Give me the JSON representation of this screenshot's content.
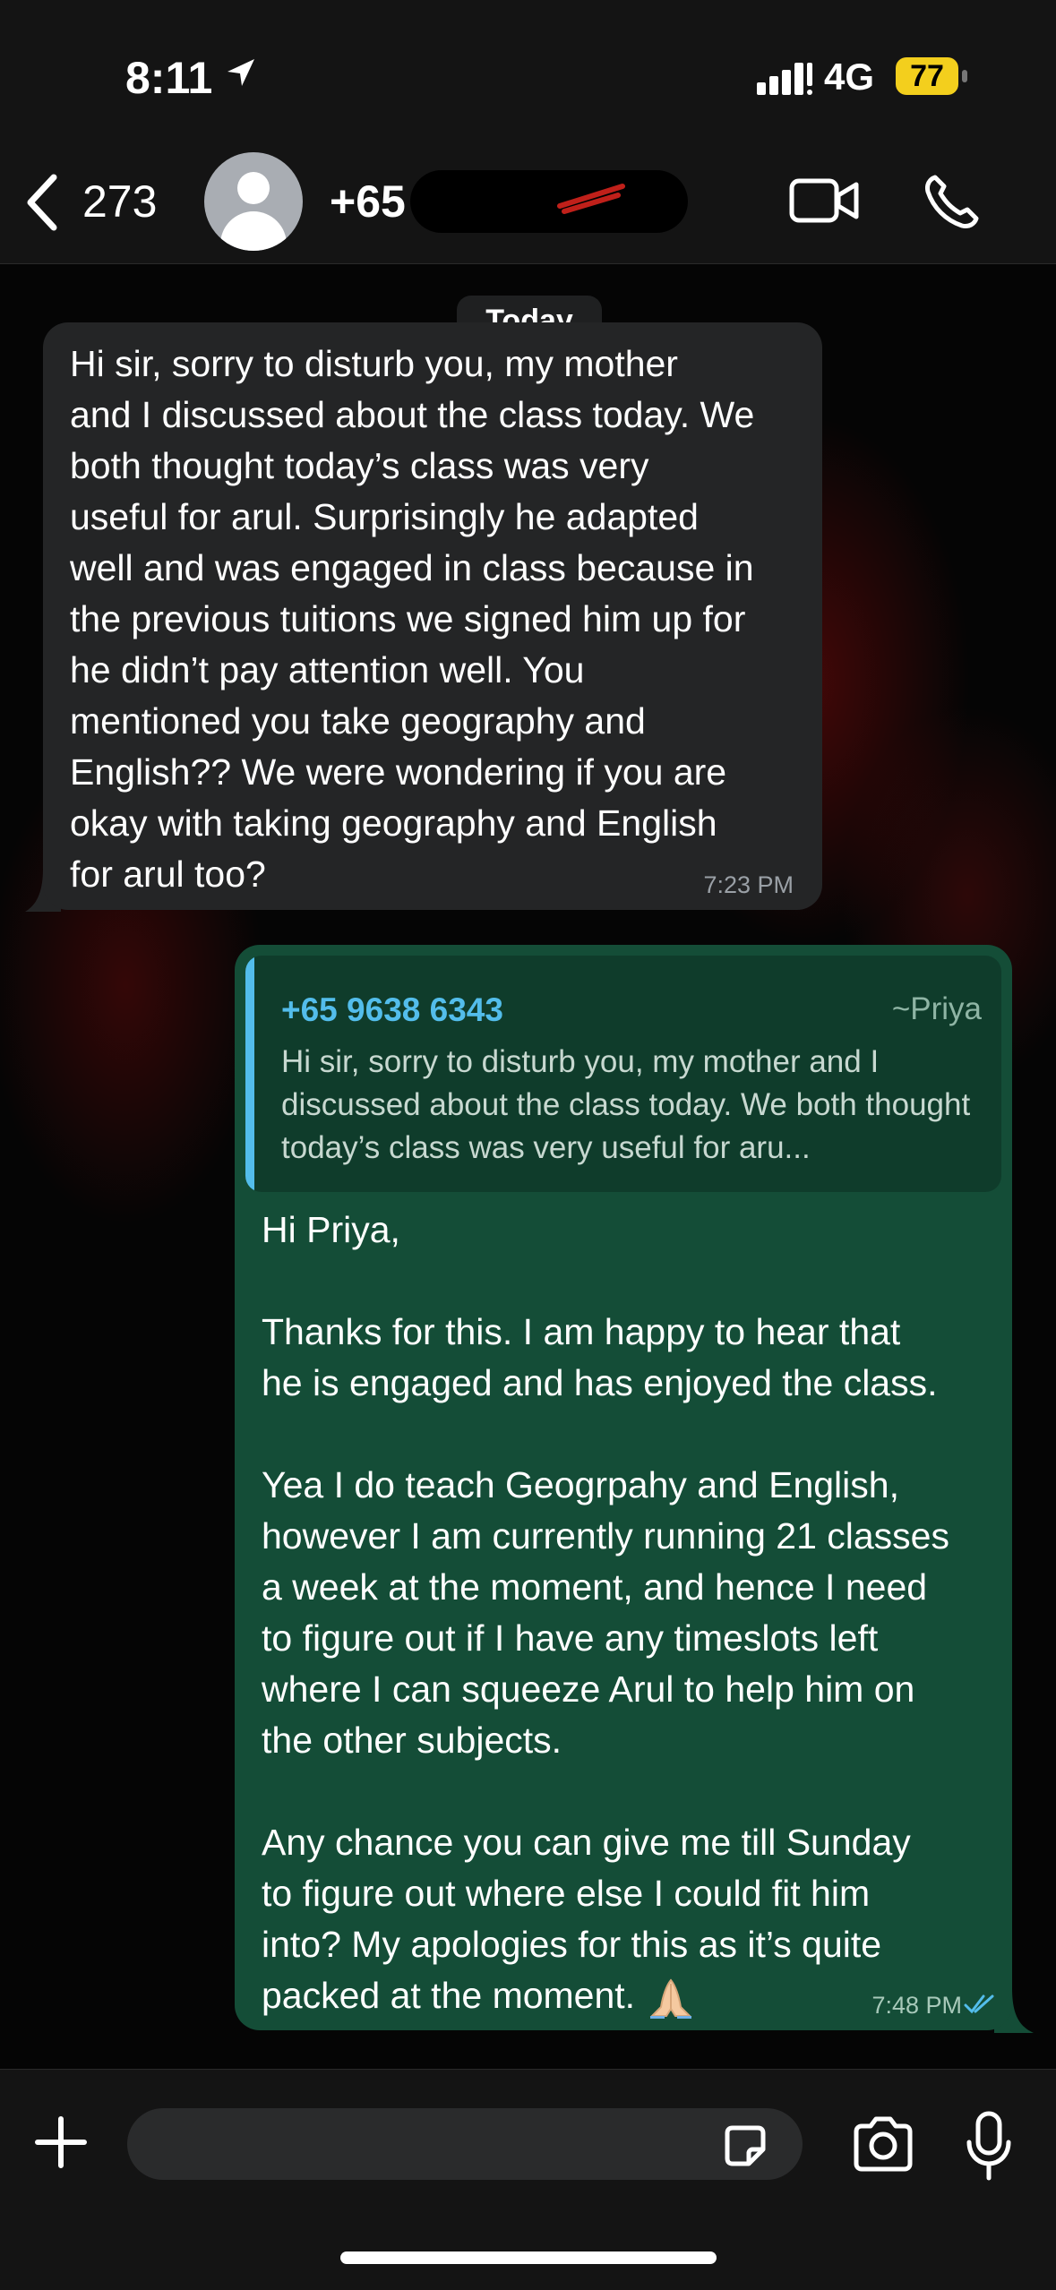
{
  "status_bar": {
    "time": "8:11",
    "network": "4G",
    "battery": "77",
    "icons": [
      "location-arrow-icon",
      "signal-icon"
    ]
  },
  "header": {
    "back_count": "273",
    "contact_name": "+65",
    "icons": [
      "chevron-left-icon",
      "avatar-icon",
      "video-call-icon",
      "phone-call-icon"
    ]
  },
  "chat": {
    "date_label": "Today",
    "messages": [
      {
        "direction": "incoming",
        "text": "Hi sir, sorry to disturb you, my mother\nand I discussed about the class today. We\nboth thought today’s class was very\nuseful for arul. Surprisingly he adapted\nwell and was engaged in class because in\nthe previous tuitions we signed him up for\nhe didn’t pay attention well. You\nmentioned you take geography and\nEnglish?? We were wondering if you are\nokay with taking geography and English\nfor arul too?",
        "time": "7:23 PM"
      },
      {
        "direction": "outgoing",
        "quoted": {
          "number": "+65 9638 6343",
          "author": "~Priya",
          "text": "Hi sir, sorry to disturb you, my mother and I discussed about the class today. We both thought today’s class was very useful for aru..."
        },
        "text": "Hi Priya,\n\nThanks for this. I am happy to hear that\nhe is engaged and has enjoyed the class.\n\nYea I do teach Geogrpahy and English,\nhowever I am currently running 21 classes\na week at the moment, and hence I need\nto figure out if I have any timeslots left\nwhere I can squeeze Arul to help him on\nthe other subjects.\n\nAny chance you can give me till Sunday\nto figure out where else I could fit him\ninto? My apologies for this as it’s quite\npacked at the moment. ",
        "emoji": "folded-hands-emoji",
        "time": "7:48 PM",
        "status_icon": "double-check-read-icon"
      }
    ]
  },
  "composer": {
    "input_value": "",
    "icons": [
      "plus-icon",
      "sticker-icon",
      "camera-icon",
      "microphone-icon"
    ]
  },
  "colors": {
    "incoming_bubble": "#242526",
    "outgoing_bubble": "#144d37",
    "accent_blue": "#53bdeb",
    "battery": "#f3cf1d"
  }
}
